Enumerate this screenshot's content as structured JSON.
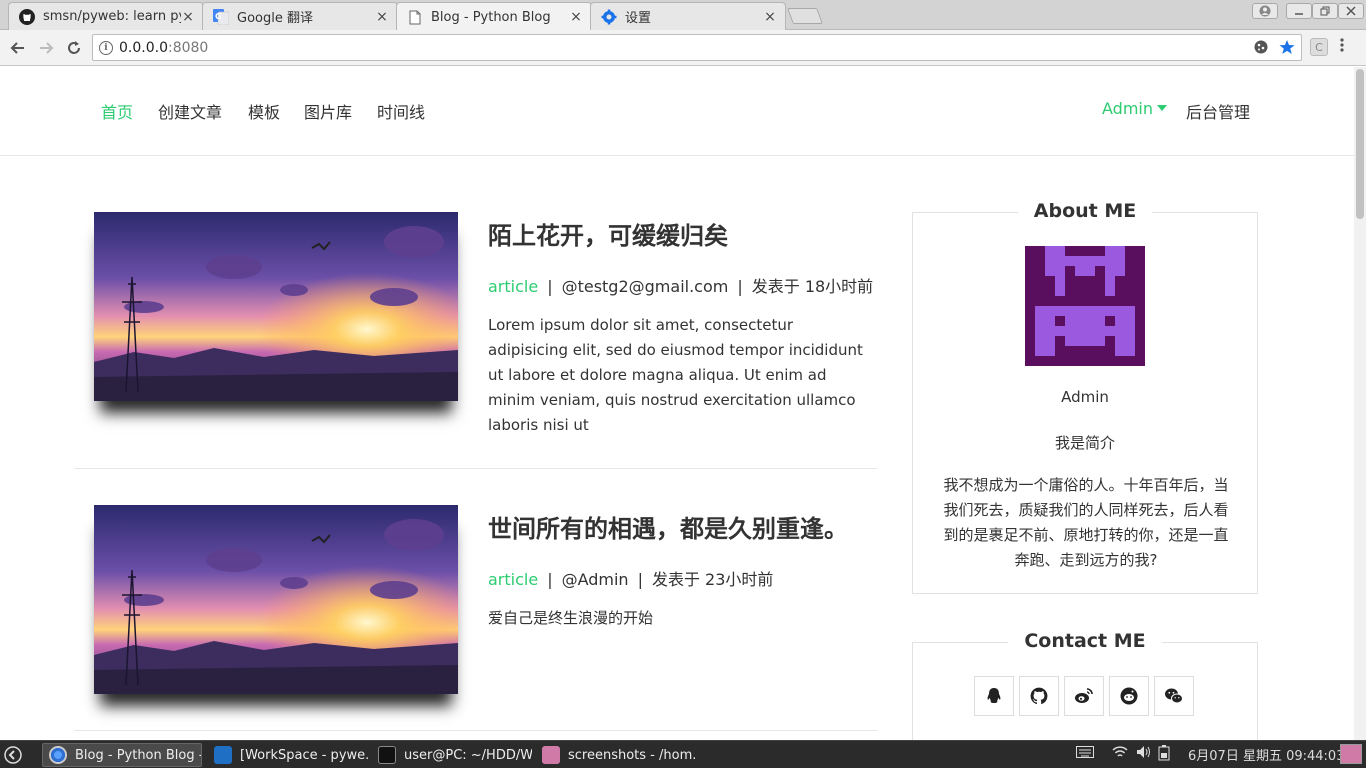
{
  "browser": {
    "tabs": [
      {
        "title": "smsn/pyweb: learn py",
        "icon": "github-icon"
      },
      {
        "title": "Google 翻译",
        "icon": "google-translate-icon"
      },
      {
        "title": "Blog - Python Blog",
        "icon": "page-icon"
      },
      {
        "title": "设置",
        "icon": "gear-icon"
      }
    ],
    "close_glyph": "×",
    "url_host": "0.0.0.0",
    "url_port": ":8080",
    "ext_label": "C"
  },
  "nav": {
    "left": [
      "首页",
      "创建文章",
      "模板",
      "图片库",
      "时间线"
    ],
    "user": "Admin",
    "admin_link": "后台管理"
  },
  "posts": [
    {
      "title": "陌上花开，可缓缓归矣",
      "category": "article",
      "author": "@testg2@gmail.com",
      "time": "发表于 18小时前",
      "excerpt": "Lorem ipsum dolor sit amet, consectetur adipisicing elit, sed do eiusmod tempor incididunt ut labore et dolore magna aliqua. Ut enim ad minim veniam, quis nostrud exercitation ullamco laboris nisi ut"
    },
    {
      "title": "世间所有的相遇，都是久别重逢。",
      "category": "article",
      "author": "@Admin",
      "time": "发表于 23小时前",
      "excerpt": "爱自己是终生浪漫的开始"
    }
  ],
  "meta_sep": "|",
  "about": {
    "heading": "About ME",
    "name": "Admin",
    "intro": "我是简介",
    "bio": "我不想成为一个庸俗的人。十年百年后，当我们死去，质疑我们的人同样死去，后人看到的是裹足不前、原地打转的你，还是一直奔跑、走到远方的我?"
  },
  "contact": {
    "heading": "Contact ME",
    "icons": [
      "qq-icon",
      "github-icon",
      "weibo-icon",
      "reddit-icon",
      "wechat-icon"
    ]
  },
  "taskbar": {
    "tasks": [
      "Blog - Python Blog - ...",
      "[WorkSpace - pywe...",
      "user@PC: ~/HDD/W...",
      "screenshots - /hom..."
    ],
    "clock": "6月07日 星期五 09:44:03"
  },
  "colors": {
    "accent": "#2ecc71",
    "avatar_bg": "#5a0e5e",
    "avatar_fg": "#9b59e0"
  }
}
